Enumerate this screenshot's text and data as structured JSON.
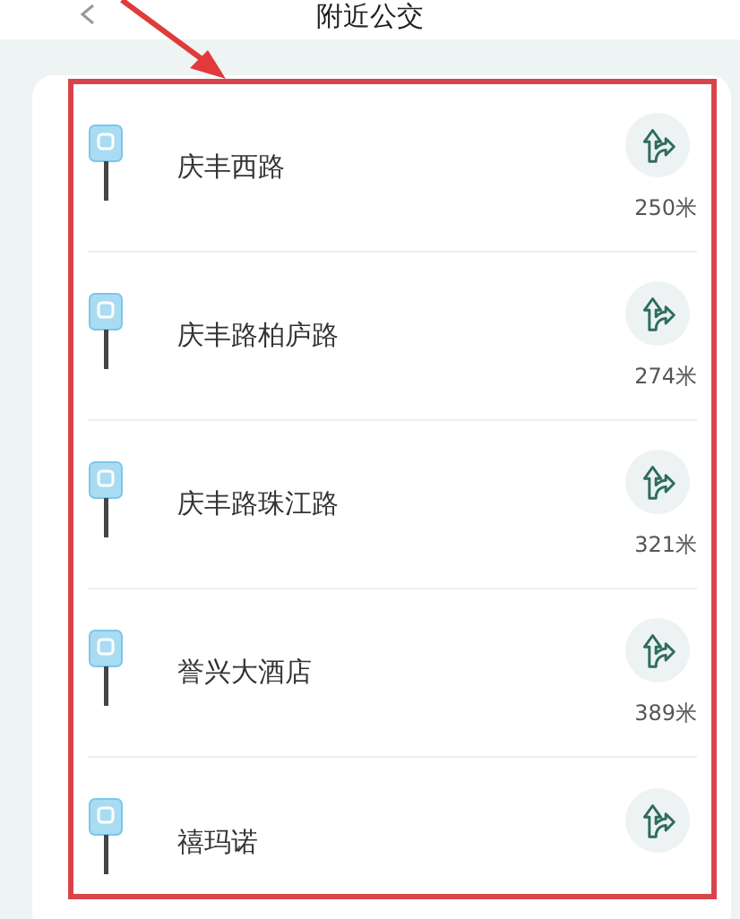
{
  "header": {
    "title": "附近公交"
  },
  "stops": [
    {
      "name": "庆丰西路",
      "distance": "250米"
    },
    {
      "name": "庆丰路柏庐路",
      "distance": "274米"
    },
    {
      "name": "庆丰路珠江路",
      "distance": "321米"
    },
    {
      "name": "誉兴大酒店",
      "distance": "389米"
    },
    {
      "name": "禧玛诺"
    }
  ]
}
